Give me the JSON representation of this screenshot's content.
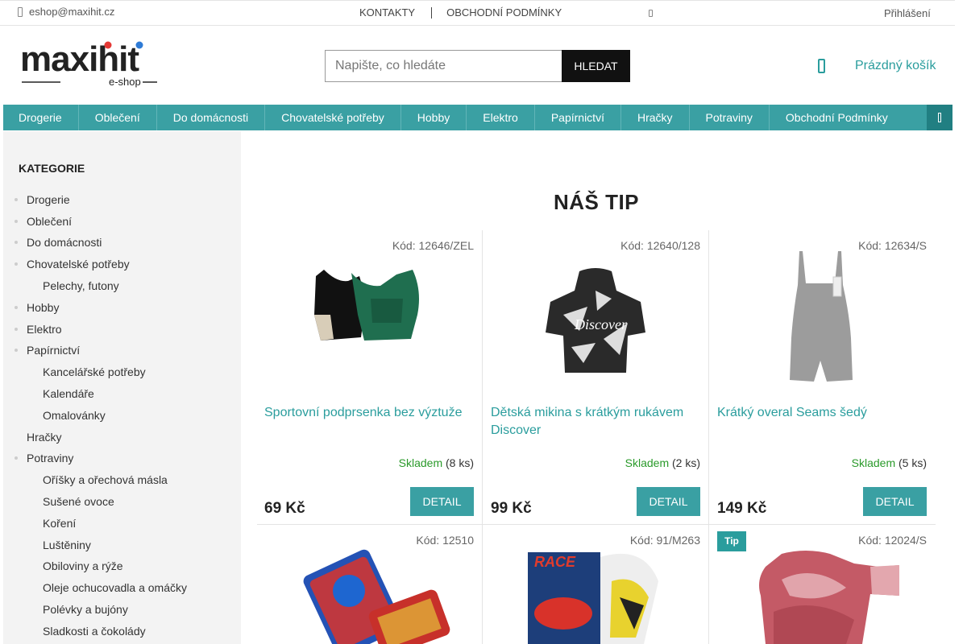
{
  "topbar": {
    "email": "eshop@maxihit.cz",
    "links": [
      "KONTAKTY",
      "OBCHODNÍ PODMÍNKY"
    ],
    "login": "Přihlášení"
  },
  "header": {
    "logo_text": "maxihit",
    "logo_sub": "e-shop",
    "search_placeholder": "Napište, co hledáte",
    "search_button": "HLEDAT",
    "cart_label": "Prázdný košík"
  },
  "nav": [
    "Drogerie",
    "Oblečení",
    "Do domácnosti",
    "Chovatelské potřeby",
    "Hobby",
    "Elektro",
    "Papírnictví",
    "Hračky",
    "Potraviny",
    "Obchodní Podmínky"
  ],
  "sidebar": {
    "title": "KATEGORIE",
    "items": [
      "Drogerie",
      "Oblečení",
      "Do domácnosti",
      "Chovatelské potřeby",
      "Pelechy, futony",
      "Hobby",
      "Elektro",
      "Papírnictví",
      "Kancelářské potřeby",
      "Kalendáře",
      "Omalovánky",
      "Hračky",
      "Potraviny",
      "Oříšky a ořechová másla",
      "Sušené ovoce",
      "Koření",
      "Luštěniny",
      "Obiloviny a rýže",
      "Oleje ochucovadla a omáčky",
      "Polévky a bujóny",
      "Sladkosti a čokolády"
    ]
  },
  "main": {
    "title": "NÁŠ TIP",
    "products": [
      {
        "code": "Kód: 12646/ZEL",
        "name": "Sportovní podprsenka bez výztuže",
        "stock": "Skladem",
        "count": "(8 ks)",
        "price": "69 Kč",
        "detail": "DETAIL"
      },
      {
        "code": "Kód: 12640/128",
        "name": "Dětská mikina s krátkým rukávem Discover",
        "stock": "Skladem",
        "count": "(2 ks)",
        "price": "99 Kč",
        "detail": "DETAIL"
      },
      {
        "code": "Kód: 12634/S",
        "name": "Krátký overal Seams šedý",
        "stock": "Skladem",
        "count": "(5 ks)",
        "price": "149 Kč",
        "detail": "DETAIL"
      },
      {
        "code": "Kód: 12510"
      },
      {
        "code": "Kód: 91/M263"
      },
      {
        "code": "Kód: 12024/S",
        "badge": "Tip"
      }
    ]
  },
  "colors": {
    "accent": "#3aa0a3",
    "link": "#2a9d9d",
    "stock": "#2a9a2a"
  }
}
